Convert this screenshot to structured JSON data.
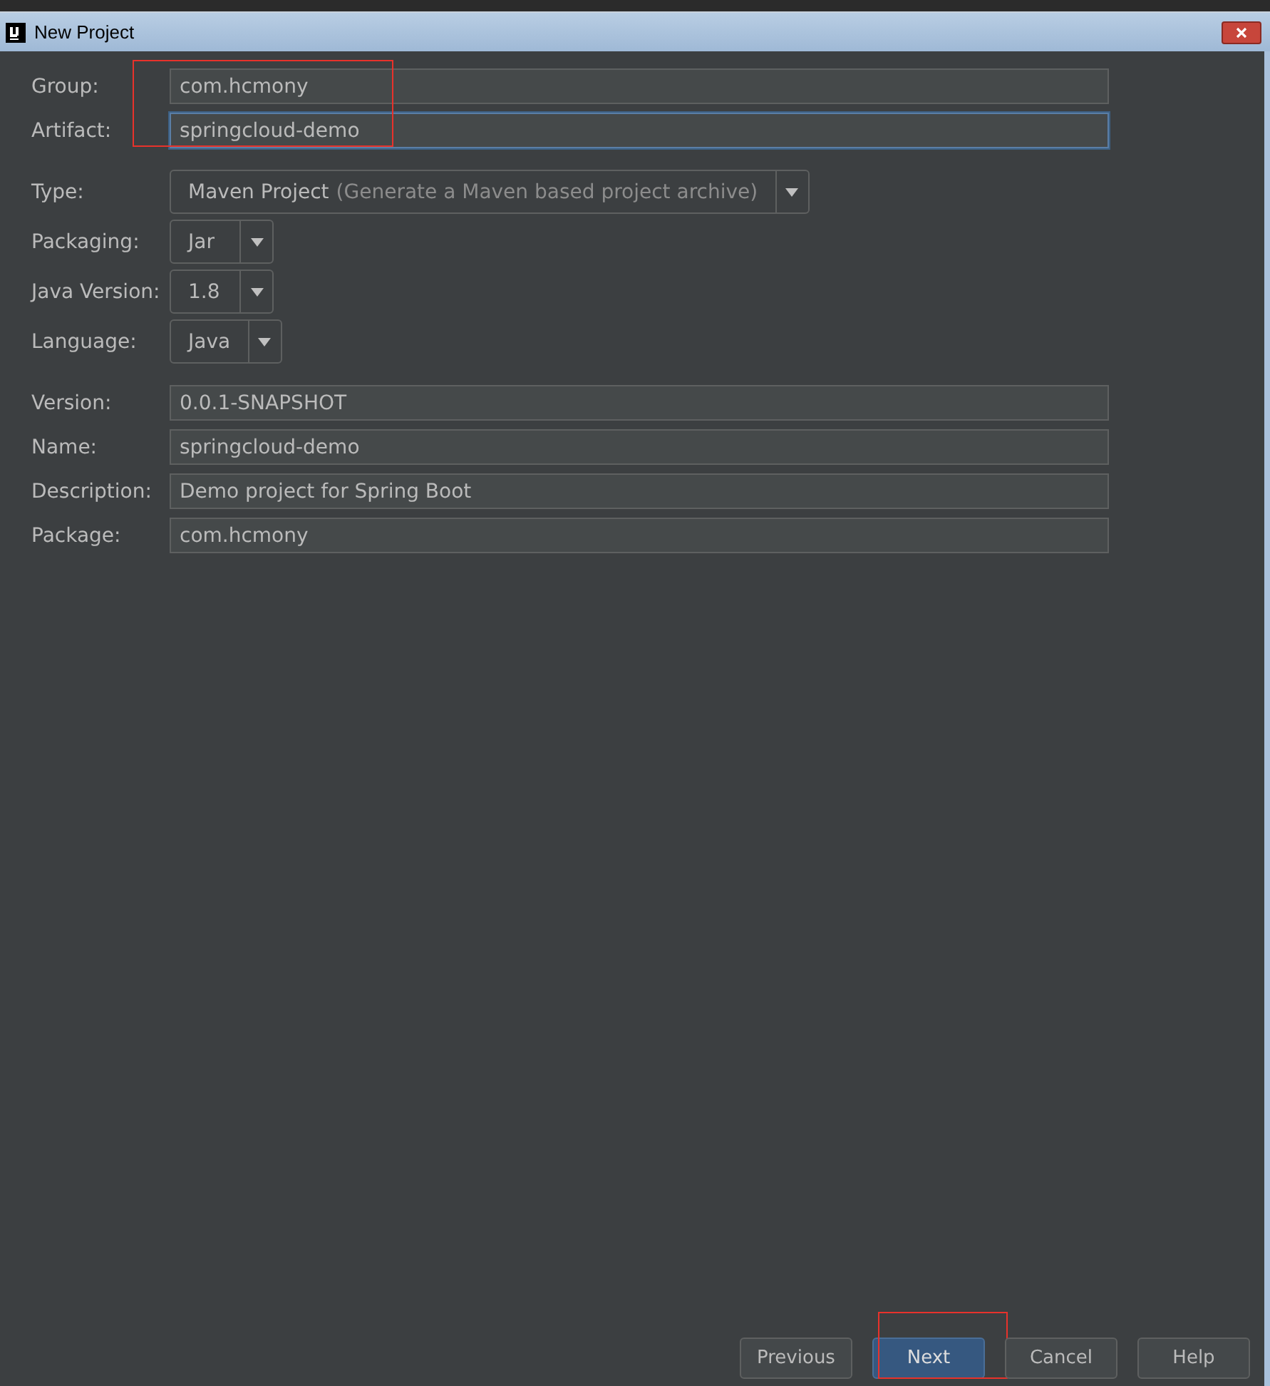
{
  "window": {
    "title": "New Project"
  },
  "form": {
    "marked": true,
    "fields": [
      {
        "kind": "text",
        "label": "Group:",
        "value": "com.hcmony",
        "focused": false
      },
      {
        "kind": "text",
        "label": "Artifact:",
        "value": "springcloud-demo",
        "focused": true
      },
      {
        "kind": "select",
        "label": "Type:",
        "value": "Maven Project",
        "hint": "(Generate a Maven based project archive)"
      },
      {
        "kind": "select",
        "label": "Packaging:",
        "value": "Jar"
      },
      {
        "kind": "select",
        "label": "Java Version:",
        "value": "1.8"
      },
      {
        "kind": "select",
        "label": "Language:",
        "value": "Java"
      },
      {
        "kind": "text",
        "label": "Version:",
        "value": "0.0.1-SNAPSHOT",
        "focused": false
      },
      {
        "kind": "text",
        "label": "Name:",
        "value": "springcloud-demo",
        "focused": false
      },
      {
        "kind": "text",
        "label": "Description:",
        "value": "Demo project for Spring Boot",
        "focused": false
      },
      {
        "kind": "text",
        "label": "Package:",
        "value": "com.hcmony",
        "focused": false
      }
    ]
  },
  "buttons": [
    {
      "label": "Previous",
      "default": false,
      "marked": false
    },
    {
      "label": "Next",
      "default": true,
      "marked": true
    },
    {
      "label": "Cancel",
      "default": false,
      "marked": false
    },
    {
      "label": "Help",
      "default": false,
      "marked": false
    }
  ]
}
